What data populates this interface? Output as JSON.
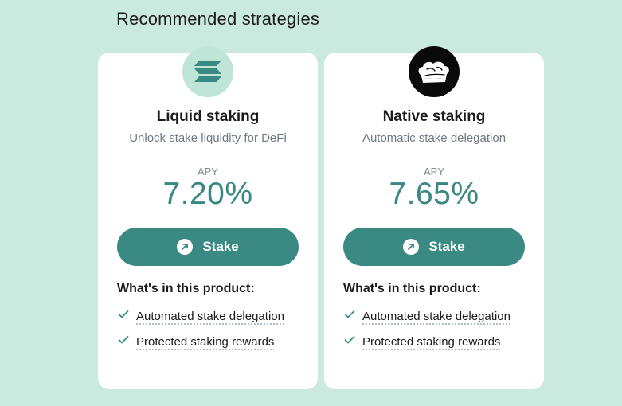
{
  "section": {
    "title": "Recommended strategies"
  },
  "colors": {
    "background": "#cbeadf",
    "accent": "#3a8a83",
    "card": "#ffffff"
  },
  "cards": [
    {
      "logo_icon": "solana-logo-icon",
      "title": "Liquid staking",
      "subtitle": "Unlock stake liquidity for DeFi",
      "apy_label": "APY",
      "apy_value": "7.20%",
      "button_label": "Stake",
      "button_icon": "arrow-up-right-icon",
      "product_heading": "What's in this product:",
      "features": [
        "Automated stake delegation",
        "Protected staking rewards"
      ]
    },
    {
      "logo_icon": "chef-hat-logo-icon",
      "title": "Native staking",
      "subtitle": "Automatic stake delegation",
      "apy_label": "APY",
      "apy_value": "7.65%",
      "button_label": "Stake",
      "button_icon": "arrow-up-right-icon",
      "product_heading": "What's in this product:",
      "features": [
        "Automated stake delegation",
        "Protected staking rewards"
      ]
    }
  ]
}
